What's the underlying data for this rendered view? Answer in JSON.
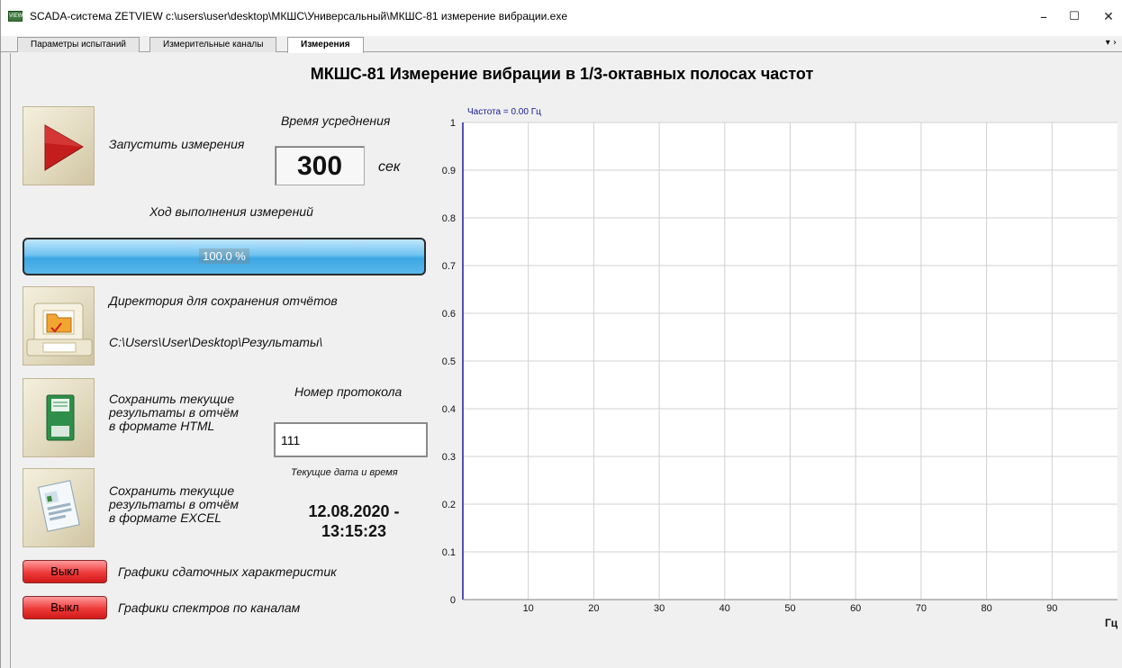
{
  "window": {
    "title": "SCADA-система ZETVIEW c:\\users\\user\\desktop\\МКШС\\Универсальный\\МКШС-81 измерение вибрации.exe",
    "app_icon_text": "VIEW",
    "minimize": "–",
    "maximize": "☐",
    "close": "✕"
  },
  "tabs": [
    {
      "label": "Параметры испытаний",
      "active": false
    },
    {
      "label": "Измерительные каналы",
      "active": false
    },
    {
      "label": "Измерения",
      "active": true
    }
  ],
  "tab_dropdown": "▾ ›",
  "page_title": "МКШС-81 Измерение вибрации в 1/3-октавных полосах частот",
  "controls": {
    "start_label": "Запустить измерения",
    "avg_time_label": "Время усреднения",
    "avg_time_value": "300",
    "avg_time_unit": "сек",
    "progress_label": "Ход выполнения измерений",
    "progress_text": "100.0 %",
    "progress_fraction": 1.0,
    "dir_label": "Директория для сохранения отчётов",
    "dir_path": "C:\\Users\\User\\Desktop\\Результаты\\",
    "save_html_label": "Сохранить текущие\nрезультаты в отчём\nв формате HTML",
    "protocol_label": "Номер протокола",
    "protocol_value": "111",
    "save_excel_label": "Сохранить текущие\nрезультаты в отчём\nв формате EXCEL",
    "datetime_caption": "Текущие дата и время",
    "datetime_value": "12.08.2020 -\n13:15:23",
    "toggle1_button": "Выкл",
    "toggle1_label": "Графики сдаточных характеристик",
    "toggle2_button": "Выкл",
    "toggle2_label": "Графики спектров по каналам"
  },
  "colors": {
    "progress": "#4fb3ea",
    "toggle_off": "#ee3a3a",
    "chart_axis": "#1a1a99",
    "chart_grid": "#d0d0d0"
  },
  "chart_data": {
    "type": "line",
    "title": "",
    "annotation": "Частота = 0.00 Гц",
    "xlabel": "Гц",
    "ylabel": "",
    "xlim": [
      0,
      100
    ],
    "ylim": [
      0,
      1
    ],
    "x_ticks": [
      10,
      20,
      30,
      40,
      50,
      60,
      70,
      80,
      90
    ],
    "y_ticks": [
      0,
      0.1,
      0.2,
      0.3,
      0.4,
      0.5,
      0.6,
      0.7,
      0.8,
      0.9,
      1
    ],
    "y_tick_labels": [
      "0",
      "0.1",
      "0.2",
      "0.3",
      "0.4",
      "0.5",
      "0.6",
      "0.7",
      "0.8",
      "0.9",
      "1"
    ],
    "grid": true,
    "series": []
  }
}
